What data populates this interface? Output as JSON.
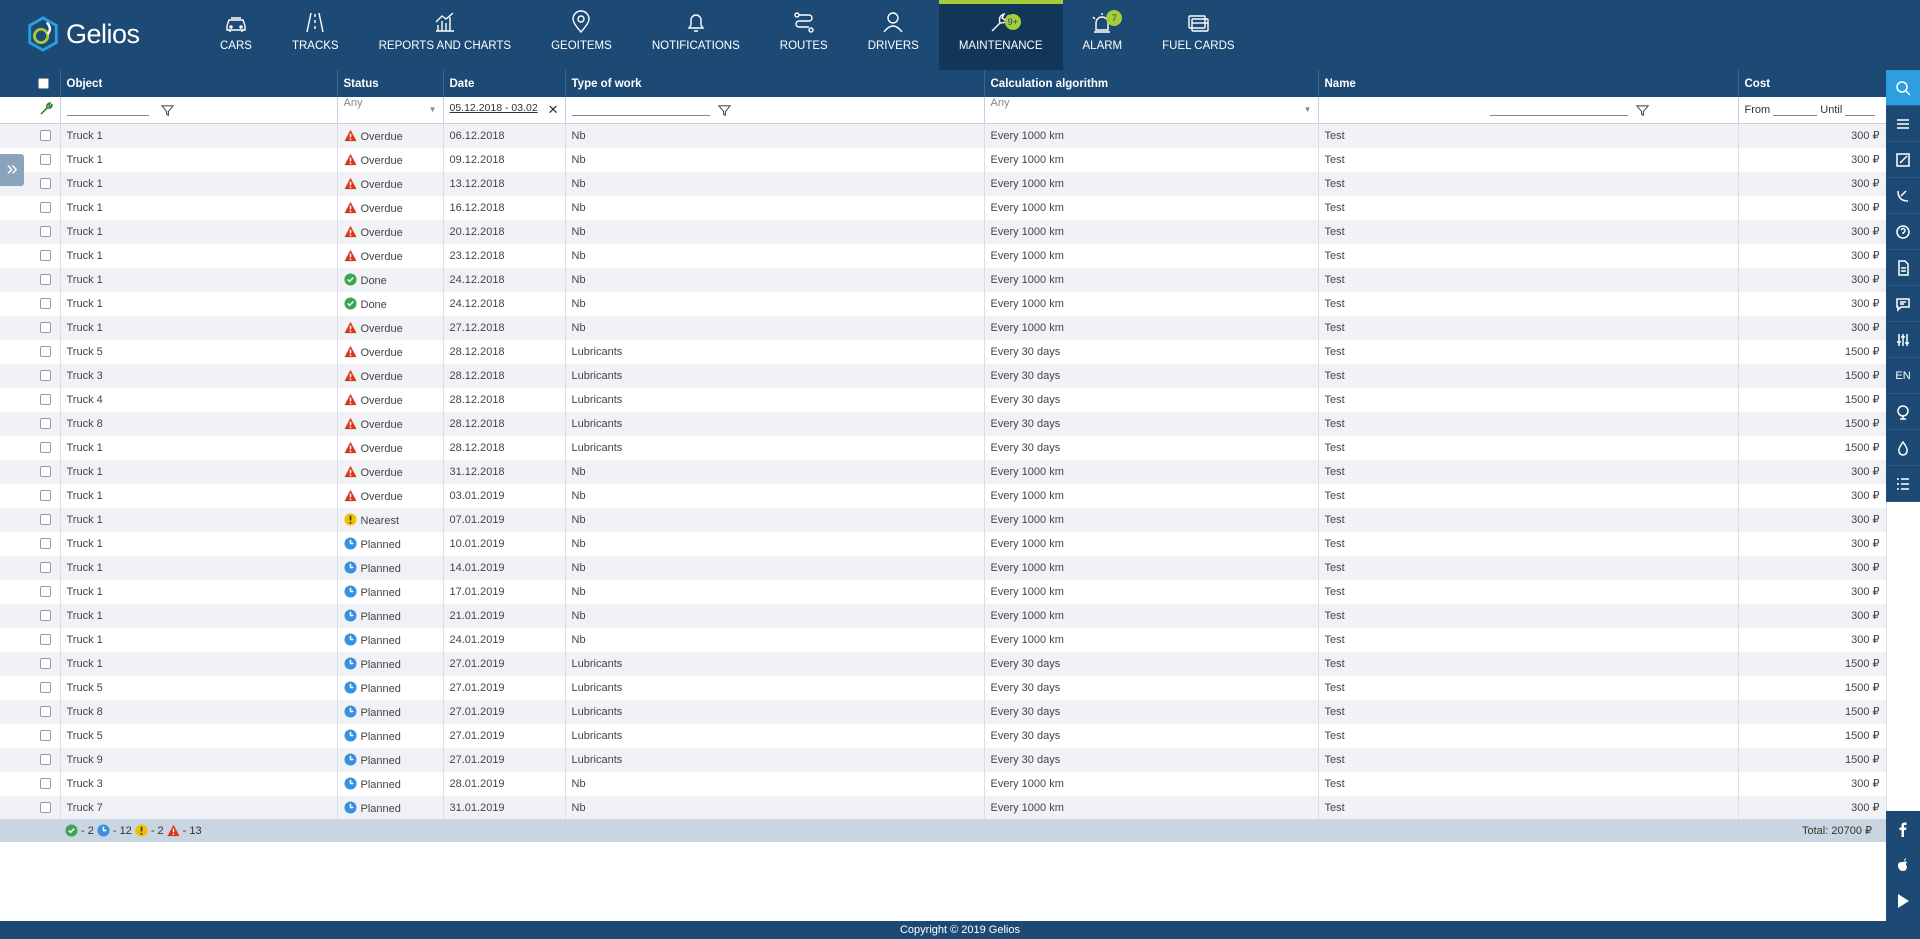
{
  "app": {
    "name": "Gelios"
  },
  "nav": [
    {
      "label": "CARS",
      "icon": "car-icon"
    },
    {
      "label": "TRACKS",
      "icon": "road-icon"
    },
    {
      "label": "REPORTS AND CHARTS",
      "icon": "chart-icon"
    },
    {
      "label": "GEOITEMS",
      "icon": "map-pin-icon"
    },
    {
      "label": "NOTIFICATIONS",
      "icon": "bell-icon"
    },
    {
      "label": "ROUTES",
      "icon": "route-icon"
    },
    {
      "label": "DRIVERS",
      "icon": "user-icon"
    },
    {
      "label": "MAINTENANCE",
      "icon": "wrench-icon",
      "badge": "9+",
      "active": true
    },
    {
      "label": "ALARM",
      "icon": "siren-icon",
      "badge": "7"
    },
    {
      "label": "FUEL CARDS",
      "icon": "cards-icon"
    }
  ],
  "columns": [
    "Object",
    "Status",
    "Date",
    "Type of work",
    "Calculation algorithm",
    "Name",
    "Cost"
  ],
  "filters": {
    "status": "Any",
    "date": "05.12.2018 - 03.02",
    "algorithm": "Any",
    "cost_from": "From",
    "cost_until": "Until"
  },
  "rows": [
    {
      "object": "Truck 1",
      "status": "Overdue",
      "date": "06.12.2018",
      "work": "Nb",
      "algo": "Every 1000 km",
      "name": "Test",
      "cost": "300 ₽"
    },
    {
      "object": "Truck 1",
      "status": "Overdue",
      "date": "09.12.2018",
      "work": "Nb",
      "algo": "Every 1000 km",
      "name": "Test",
      "cost": "300 ₽"
    },
    {
      "object": "Truck 1",
      "status": "Overdue",
      "date": "13.12.2018",
      "work": "Nb",
      "algo": "Every 1000 km",
      "name": "Test",
      "cost": "300 ₽"
    },
    {
      "object": "Truck 1",
      "status": "Overdue",
      "date": "16.12.2018",
      "work": "Nb",
      "algo": "Every 1000 km",
      "name": "Test",
      "cost": "300 ₽"
    },
    {
      "object": "Truck 1",
      "status": "Overdue",
      "date": "20.12.2018",
      "work": "Nb",
      "algo": "Every 1000 km",
      "name": "Test",
      "cost": "300 ₽"
    },
    {
      "object": "Truck 1",
      "status": "Overdue",
      "date": "23.12.2018",
      "work": "Nb",
      "algo": "Every 1000 km",
      "name": "Test",
      "cost": "300 ₽"
    },
    {
      "object": "Truck 1",
      "status": "Done",
      "date": "24.12.2018",
      "work": "Nb",
      "algo": "Every 1000 km",
      "name": "Test",
      "cost": "300 ₽"
    },
    {
      "object": "Truck 1",
      "status": "Done",
      "date": "24.12.2018",
      "work": "Nb",
      "algo": "Every 1000 km",
      "name": "Test",
      "cost": "300 ₽"
    },
    {
      "object": "Truck 1",
      "status": "Overdue",
      "date": "27.12.2018",
      "work": "Nb",
      "algo": "Every 1000 km",
      "name": "Test",
      "cost": "300 ₽"
    },
    {
      "object": "Truck 5",
      "status": "Overdue",
      "date": "28.12.2018",
      "work": "Lubricants",
      "algo": "Every 30 days",
      "name": "Test",
      "cost": "1500 ₽"
    },
    {
      "object": "Truck 3",
      "status": "Overdue",
      "date": "28.12.2018",
      "work": "Lubricants",
      "algo": "Every 30 days",
      "name": "Test",
      "cost": "1500 ₽"
    },
    {
      "object": "Truck 4",
      "status": "Overdue",
      "date": "28.12.2018",
      "work": "Lubricants",
      "algo": "Every 30 days",
      "name": "Test",
      "cost": "1500 ₽"
    },
    {
      "object": "Truck 8",
      "status": "Overdue",
      "date": "28.12.2018",
      "work": "Lubricants",
      "algo": "Every 30 days",
      "name": "Test",
      "cost": "1500 ₽"
    },
    {
      "object": "Truck 1",
      "status": "Overdue",
      "date": "28.12.2018",
      "work": "Lubricants",
      "algo": "Every 30 days",
      "name": "Test",
      "cost": "1500 ₽"
    },
    {
      "object": "Truck 1",
      "status": "Overdue",
      "date": "31.12.2018",
      "work": "Nb",
      "algo": "Every 1000 km",
      "name": "Test",
      "cost": "300 ₽"
    },
    {
      "object": "Truck 1",
      "status": "Overdue",
      "date": "03.01.2019",
      "work": "Nb",
      "algo": "Every 1000 km",
      "name": "Test",
      "cost": "300 ₽"
    },
    {
      "object": "Truck 1",
      "status": "Nearest",
      "date": "07.01.2019",
      "work": "Nb",
      "algo": "Every 1000 km",
      "name": "Test",
      "cost": "300 ₽"
    },
    {
      "object": "Truck 1",
      "status": "Planned",
      "date": "10.01.2019",
      "work": "Nb",
      "algo": "Every 1000 km",
      "name": "Test",
      "cost": "300 ₽"
    },
    {
      "object": "Truck 1",
      "status": "Planned",
      "date": "14.01.2019",
      "work": "Nb",
      "algo": "Every 1000 km",
      "name": "Test",
      "cost": "300 ₽"
    },
    {
      "object": "Truck 1",
      "status": "Planned",
      "date": "17.01.2019",
      "work": "Nb",
      "algo": "Every 1000 km",
      "name": "Test",
      "cost": "300 ₽"
    },
    {
      "object": "Truck 1",
      "status": "Planned",
      "date": "21.01.2019",
      "work": "Nb",
      "algo": "Every 1000 km",
      "name": "Test",
      "cost": "300 ₽"
    },
    {
      "object": "Truck 1",
      "status": "Planned",
      "date": "24.01.2019",
      "work": "Nb",
      "algo": "Every 1000 km",
      "name": "Test",
      "cost": "300 ₽"
    },
    {
      "object": "Truck 1",
      "status": "Planned",
      "date": "27.01.2019",
      "work": "Lubricants",
      "algo": "Every 30 days",
      "name": "Test",
      "cost": "1500 ₽"
    },
    {
      "object": "Truck 5",
      "status": "Planned",
      "date": "27.01.2019",
      "work": "Lubricants",
      "algo": "Every 30 days",
      "name": "Test",
      "cost": "1500 ₽"
    },
    {
      "object": "Truck 8",
      "status": "Planned",
      "date": "27.01.2019",
      "work": "Lubricants",
      "algo": "Every 30 days",
      "name": "Test",
      "cost": "1500 ₽"
    },
    {
      "object": "Truck 5",
      "status": "Planned",
      "date": "27.01.2019",
      "work": "Lubricants",
      "algo": "Every 30 days",
      "name": "Test",
      "cost": "1500 ₽"
    },
    {
      "object": "Truck 9",
      "status": "Planned",
      "date": "27.01.2019",
      "work": "Lubricants",
      "algo": "Every 30 days",
      "name": "Test",
      "cost": "1500 ₽"
    },
    {
      "object": "Truck 3",
      "status": "Planned",
      "date": "28.01.2019",
      "work": "Nb",
      "algo": "Every 1000 km",
      "name": "Test",
      "cost": "300 ₽"
    },
    {
      "object": "Truck 7",
      "status": "Planned",
      "date": "31.01.2019",
      "work": "Nb",
      "algo": "Every 1000 km",
      "name": "Test",
      "cost": "300 ₽"
    }
  ],
  "summary": {
    "done": "- 2",
    "planned": "- 12",
    "nearest": "- 2",
    "overdue": "- 13",
    "total": "Total: 20700 ₽"
  },
  "rightbar": [
    {
      "icon": "search-icon"
    },
    {
      "icon": "menu-icon"
    },
    {
      "icon": "edit-icon"
    },
    {
      "icon": "satellite-icon"
    },
    {
      "icon": "help-icon"
    },
    {
      "icon": "document-icon"
    },
    {
      "icon": "chat-icon"
    },
    {
      "icon": "sliders-icon"
    },
    {
      "icon": "language-icon",
      "label": "EN"
    },
    {
      "icon": "globe-icon"
    },
    {
      "icon": "drop-icon"
    },
    {
      "icon": "list-icon"
    }
  ],
  "social": [
    {
      "icon": "facebook-icon"
    },
    {
      "icon": "apple-icon"
    },
    {
      "icon": "google-play-icon"
    }
  ],
  "footer": "Copyright © 2019 Gelios",
  "colors": {
    "header": "#1d4a74",
    "accent": "#a5cd39",
    "overdue": "#d9361e",
    "done": "#3aa655",
    "planned": "#3a90e0",
    "nearest": "#f0c000"
  }
}
